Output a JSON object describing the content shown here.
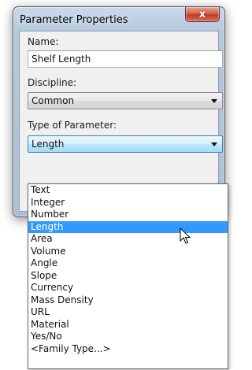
{
  "window": {
    "title": "Parameter Properties",
    "close_glyph": "x"
  },
  "form": {
    "name_label": "Name:",
    "name_value": "Shelf Length",
    "discipline_label": "Discipline:",
    "discipline_value": "Common",
    "type_label": "Type of Parameter:",
    "type_value": "Length"
  },
  "dropdown": {
    "options": [
      "Text",
      "Integer",
      "Number",
      "Length",
      "Area",
      "Volume",
      "Angle",
      "Slope",
      "Currency",
      "Mass Density",
      "URL",
      "Material",
      "Yes/No",
      "<Family Type...>"
    ],
    "selected": "Length"
  },
  "icons": {
    "close": "close-icon",
    "arrow": "chevron-down-icon",
    "cursor": "mouse-pointer-icon"
  }
}
